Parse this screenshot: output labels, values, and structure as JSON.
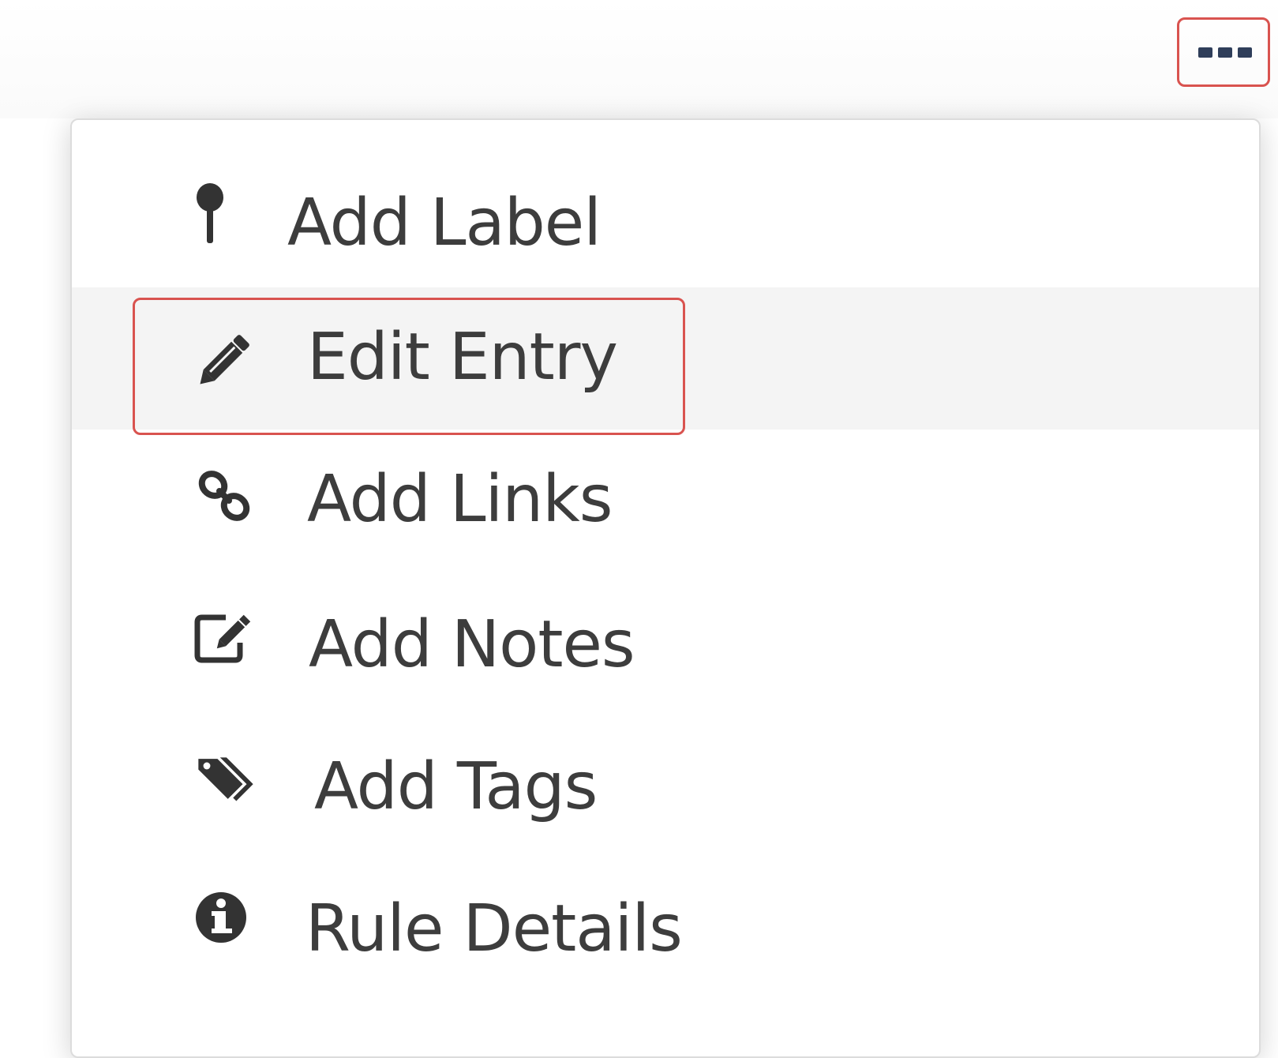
{
  "toolbar": {
    "more_button_icon": "ellipsis-icon"
  },
  "menu": {
    "items": [
      {
        "label": "Add Label",
        "icon": "pushpin-icon"
      },
      {
        "label": "Edit Entry",
        "icon": "pencil-icon",
        "state": "hovered"
      },
      {
        "label": "Add Links",
        "icon": "link-icon"
      },
      {
        "label": "Add Notes",
        "icon": "edit-note-icon"
      },
      {
        "label": "Add Tags",
        "icon": "tags-icon"
      },
      {
        "label": "Rule Details",
        "icon": "info-circle-icon"
      }
    ]
  },
  "colors": {
    "highlight_border": "#d9534f",
    "hover_background": "#f4f4f4",
    "text": "#3d3d3d",
    "icon": "#333333"
  }
}
